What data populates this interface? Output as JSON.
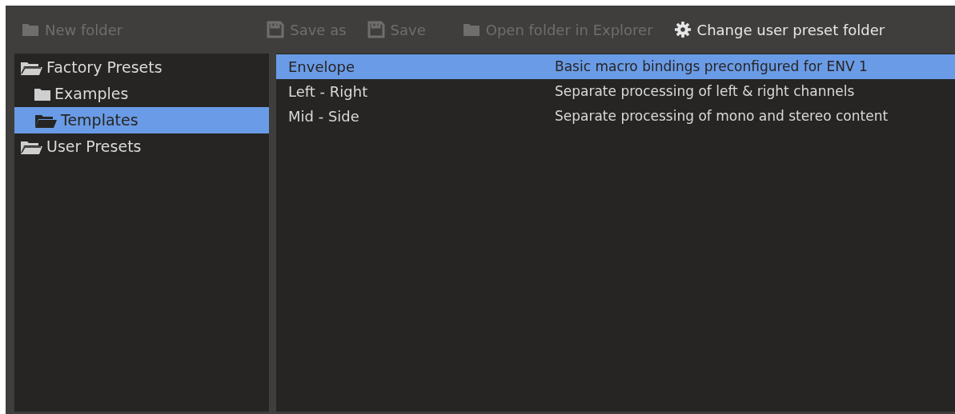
{
  "toolbar": [
    {
      "kind": "folder",
      "label": "New folder",
      "disabled": true
    },
    {
      "kind": "save",
      "label": "Save as",
      "disabled": true
    },
    {
      "kind": "save",
      "label": "Save",
      "disabled": true
    },
    {
      "kind": "folder",
      "label": "Open folder in Explorer",
      "disabled": true
    },
    {
      "kind": "gear",
      "label": "Change user preset folder",
      "disabled": false
    }
  ],
  "tree": [
    {
      "label": "Factory Presets",
      "expanded": true,
      "selected": false,
      "children": [
        {
          "label": "Examples",
          "expanded": false,
          "selected": false
        },
        {
          "label": "Templates",
          "expanded": true,
          "selected": true
        }
      ]
    },
    {
      "label": "User Presets",
      "expanded": true,
      "selected": false
    }
  ],
  "presets": [
    {
      "name": "Envelope",
      "description": "Basic macro bindings preconfigured for ENV 1",
      "selected": true
    },
    {
      "name": "Left - Right",
      "description": "Separate processing of left & right channels",
      "selected": false
    },
    {
      "name": "Mid - Side",
      "description": "Separate processing of mono and stereo content",
      "selected": false
    }
  ]
}
